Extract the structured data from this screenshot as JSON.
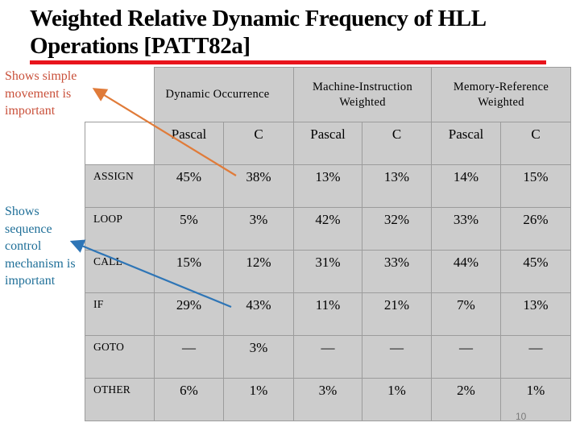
{
  "slide": {
    "title_line1": "Weighted Relative Dynamic Frequency of HLL",
    "title_line2": "Operations [PATT82a]",
    "page_number": "10",
    "colors": {
      "title_rule": "#e8141c",
      "note_simple": "#c9503a",
      "note_sequence": "#1f6f98",
      "arrow_orange": "#e07b39",
      "arrow_blue": "#2e75b6",
      "table_fill": "#cccccc"
    }
  },
  "annotations": {
    "simple_movement": [
      "Shows simple",
      "movement is",
      "important"
    ],
    "sequence_control": [
      "Shows",
      "sequence",
      "control",
      "mechanism is",
      "important"
    ]
  },
  "table": {
    "group_headers": [
      {
        "label_lines": [
          "Dynamic Occurrence"
        ]
      },
      {
        "label_lines": [
          "Machine-Instruction",
          "Weighted"
        ]
      },
      {
        "label_lines": [
          "Memory-Reference",
          "Weighted"
        ]
      }
    ],
    "sub_headers": [
      "Pascal",
      "C",
      "Pascal",
      "C",
      "Pascal",
      "C"
    ],
    "rows": [
      {
        "label": "ASSIGN",
        "values": [
          "45%",
          "38%",
          "13%",
          "13%",
          "14%",
          "15%"
        ]
      },
      {
        "label": "LOOP",
        "values": [
          "5%",
          "3%",
          "42%",
          "32%",
          "33%",
          "26%"
        ]
      },
      {
        "label": "CALL",
        "values": [
          "15%",
          "12%",
          "31%",
          "33%",
          "44%",
          "45%"
        ]
      },
      {
        "label": "IF",
        "values": [
          "29%",
          "43%",
          "11%",
          "21%",
          "7%",
          "13%"
        ]
      },
      {
        "label": "GOTO",
        "values": [
          "—",
          "3%",
          "—",
          "—",
          "—",
          "—"
        ]
      },
      {
        "label": "OTHER",
        "values": [
          "6%",
          "1%",
          "3%",
          "1%",
          "2%",
          "1%"
        ]
      }
    ]
  }
}
